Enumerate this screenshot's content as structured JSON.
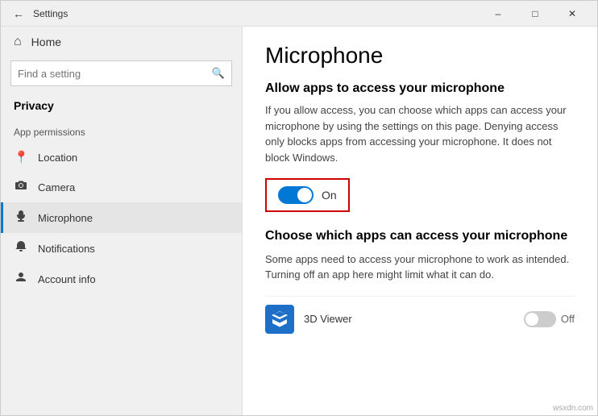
{
  "titlebar": {
    "title": "Settings",
    "back_label": "←",
    "minimize": "–",
    "maximize": "□",
    "close": "✕"
  },
  "sidebar": {
    "home_label": "Home",
    "search_placeholder": "Find a setting",
    "privacy_label": "Privacy",
    "app_permissions_label": "App permissions",
    "nav_items": [
      {
        "id": "location",
        "label": "Location",
        "icon": "📍"
      },
      {
        "id": "camera",
        "label": "Camera",
        "icon": "📷"
      },
      {
        "id": "microphone",
        "label": "Microphone",
        "icon": "🎤",
        "active": true
      },
      {
        "id": "notifications",
        "label": "Notifications",
        "icon": "🔔"
      },
      {
        "id": "account-info",
        "label": "Account info",
        "icon": "👤"
      }
    ]
  },
  "main": {
    "page_title": "Microphone",
    "allow_heading": "Allow apps to access your microphone",
    "allow_desc": "If you allow access, you can choose which apps can access your microphone by using the settings on this page. Denying access only blocks apps from accessing your microphone. It does not block Windows.",
    "toggle_on_label": "On",
    "choose_heading": "Choose which apps can access your microphone",
    "choose_desc": "Some apps need to access your microphone to work as intended. Turning off an app here might limit what it can do.",
    "apps": [
      {
        "name": "3D Viewer",
        "toggle_label": "Off",
        "icon_color": "#1e6fc8"
      }
    ]
  },
  "watermark": "wsxdn.com"
}
